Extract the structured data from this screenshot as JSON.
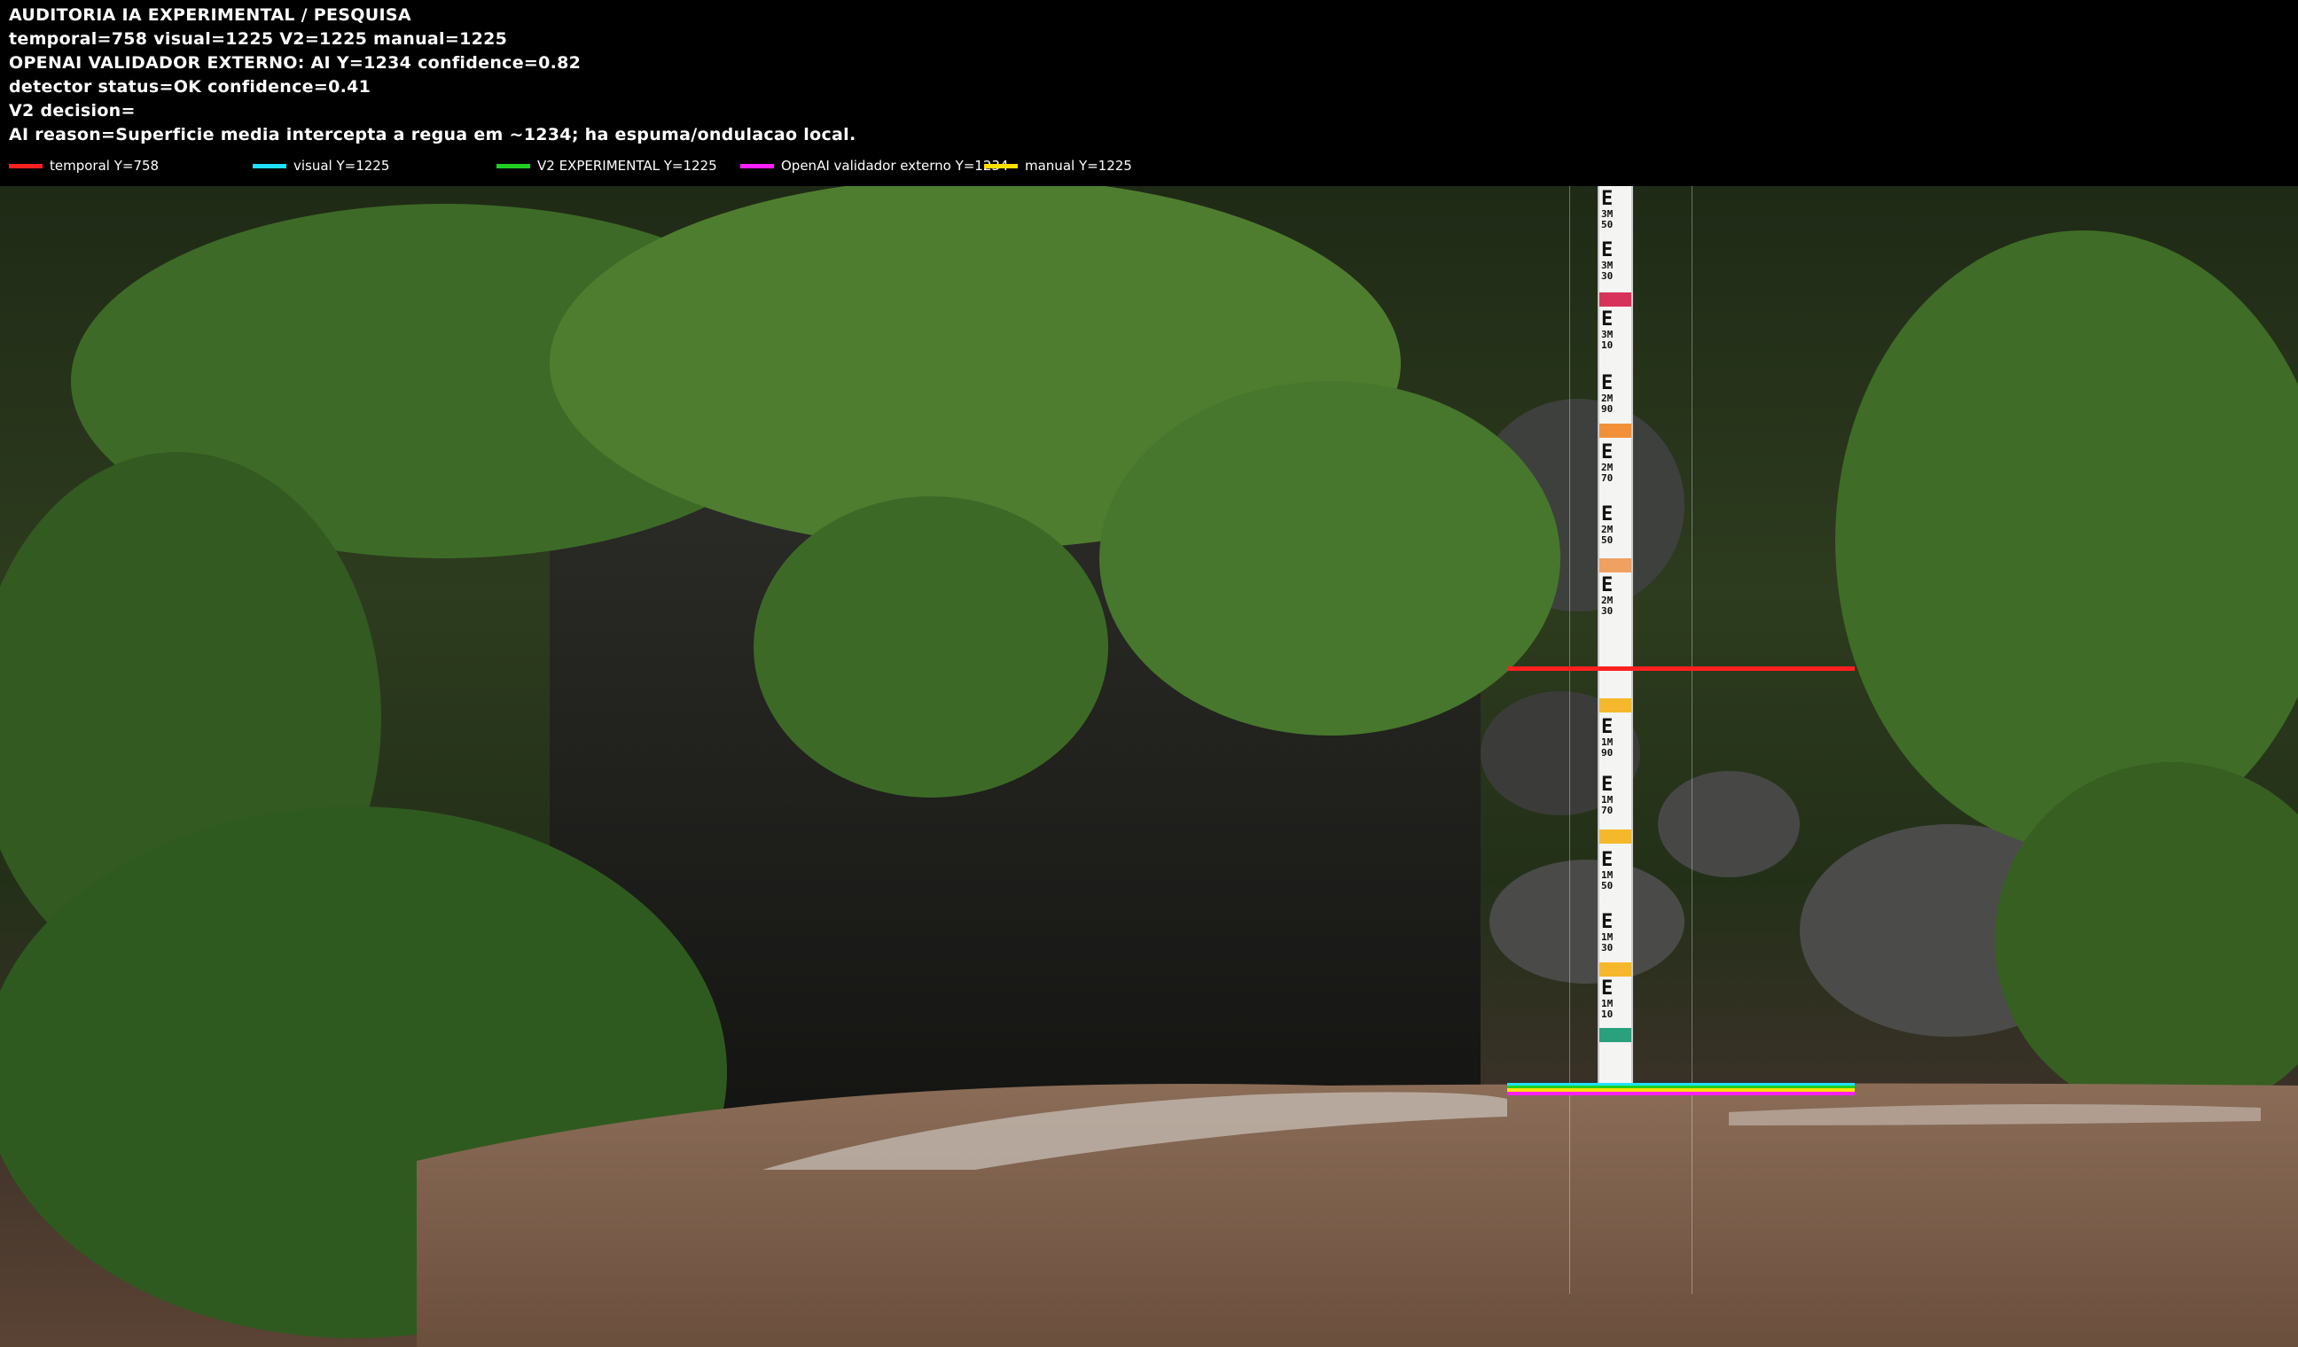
{
  "hud": {
    "title": "AUDITORIA IA  EXPERIMENTAL / PESQUISA",
    "readings": "temporal=758  visual=1225  V2=1225  manual=1225",
    "openai": "OPENAI  VALIDADOR EXTERNO: AI Y=1234  confidence=0.82",
    "detector": "detector status=OK confidence=0.41",
    "decision": "V2 decision=",
    "reason": "AI reason=Superficie media intercepta a regua em ~1234; ha espuma/ondulacao local."
  },
  "legend": [
    {
      "label": "temporal Y=758",
      "color": "#ff2020"
    },
    {
      "label": "visual Y=1225",
      "color": "#20e0ff"
    },
    {
      "label": "V2 EXPERIMENTAL Y=1225",
      "color": "#20d020"
    },
    {
      "label": "OpenAI validador externo Y=1234",
      "color": "#ff20ff"
    },
    {
      "label": "manual Y=1225",
      "color": "#ffe000"
    }
  ],
  "gauge": {
    "marks": [
      "3M 50",
      "3M 30",
      "3M 10",
      "2M 90",
      "2M 70",
      "2M 50",
      "2M 30",
      "1M 90",
      "1M 70",
      "1M 50",
      "1M 30",
      "1M 10"
    ]
  },
  "colors": {
    "temporal": "#ff2020",
    "visual": "#20e0ff",
    "v2": "#20d020",
    "openai": "#ff20ff",
    "manual": "#ffe000"
  },
  "icons": [
    "red-line-swatch",
    "cyan-line-swatch",
    "green-line-swatch",
    "magenta-line-swatch",
    "yellow-line-swatch"
  ]
}
